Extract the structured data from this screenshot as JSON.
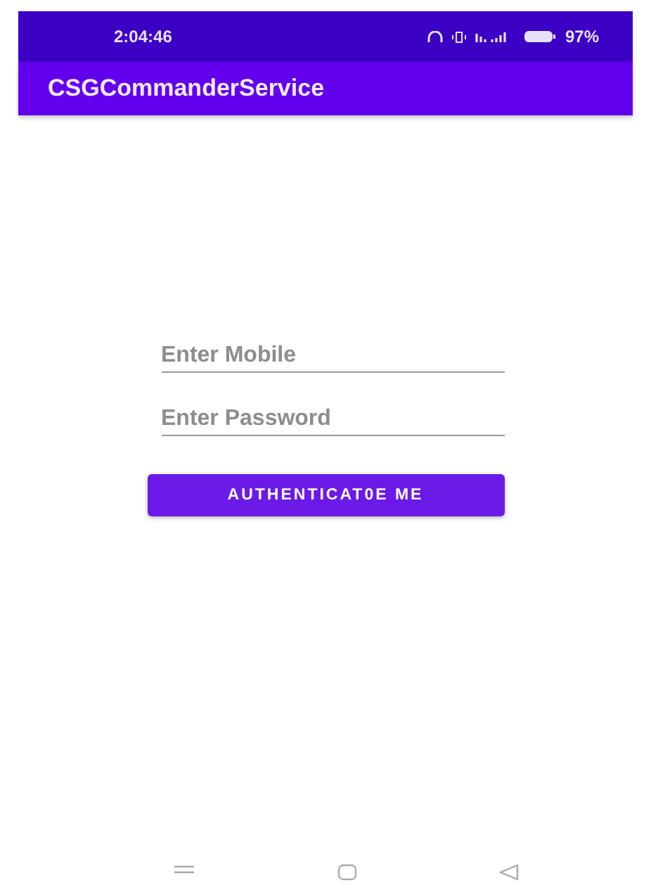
{
  "status_bar": {
    "time": "2:04:46",
    "battery": "97%"
  },
  "app_bar": {
    "title": "CSGCommanderService"
  },
  "form": {
    "fields": [
      {
        "placeholder": "Enter Mobile"
      },
      {
        "placeholder": "Enter Password"
      }
    ],
    "button": "AUTHENTICAT0E ME"
  }
}
